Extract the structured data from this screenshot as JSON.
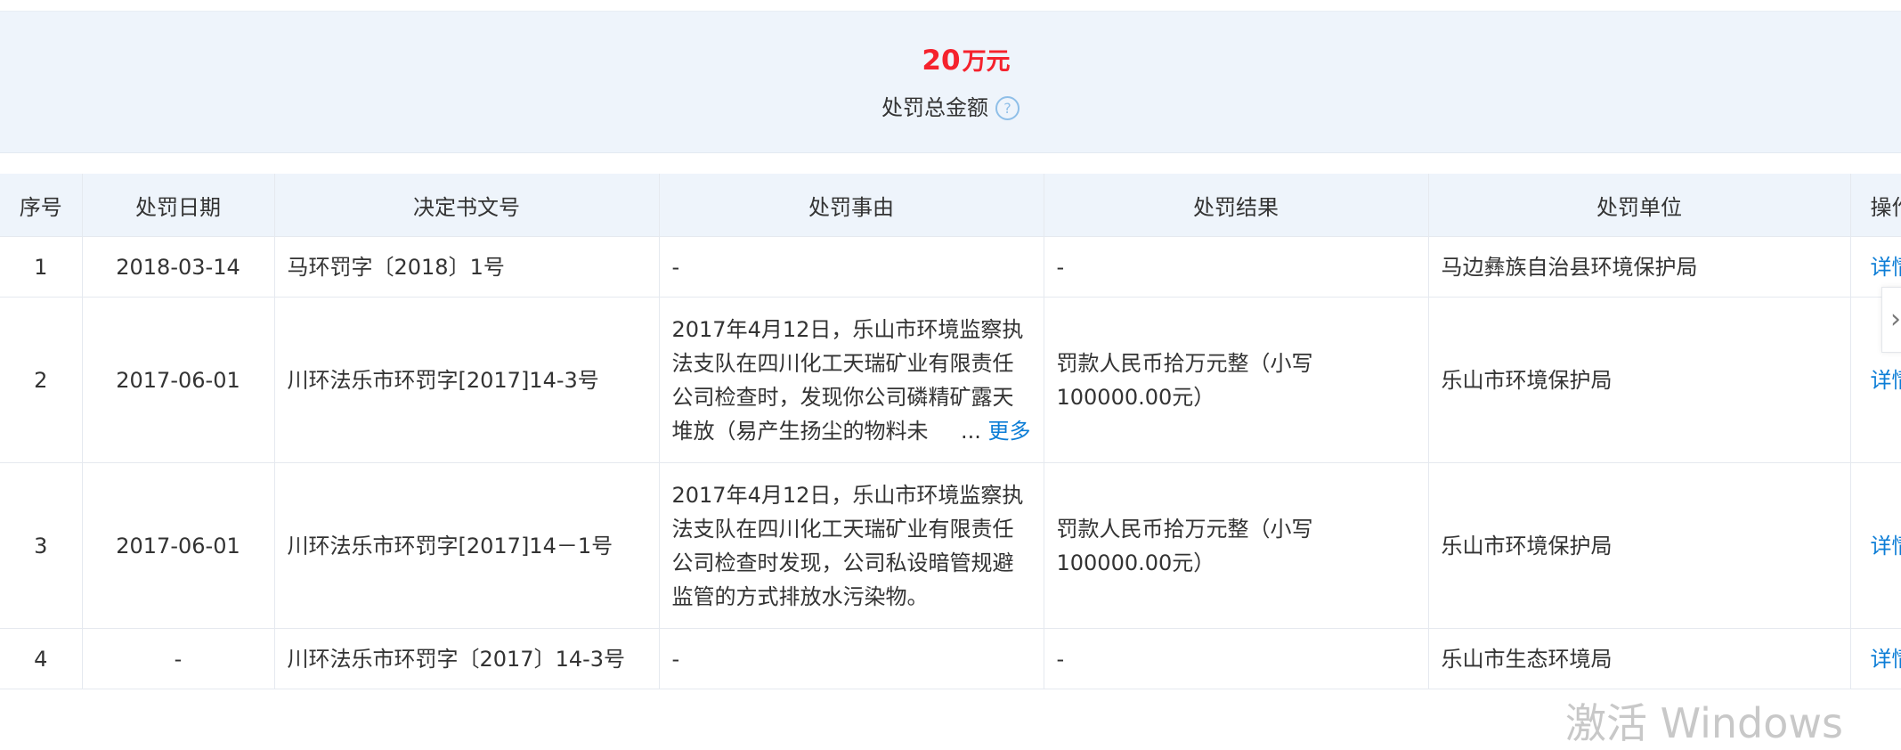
{
  "summary": {
    "amount_value": "20",
    "amount_unit": "万元",
    "label": "处罚总金额",
    "help_icon": "?"
  },
  "table": {
    "headers": [
      "序号",
      "处罚日期",
      "决定书文号",
      "处罚事由",
      "处罚结果",
      "处罚单位",
      "操作"
    ],
    "rows": [
      {
        "index": "1",
        "date": "2018-03-14",
        "doc_no": "马环罚字〔2018〕1号",
        "reason": "-",
        "result": "-",
        "unit": "马边彝族自治县环境保护局",
        "action": "详情"
      },
      {
        "index": "2",
        "date": "2017-06-01",
        "doc_no": "川环法乐市环罚字[2017]14-3号",
        "reason": "2017年4月12日，乐山市环境监察执法支队在四川化工天瑞矿业有限责任公司检查时，发现你公司磷精矿露天堆放（易产生扬尘的物料未",
        "reason_ellipsis": "...",
        "more": "更多",
        "result": "罚款人民币拾万元整（小写100000.00元）",
        "unit": "乐山市环境保护局",
        "action": "详情"
      },
      {
        "index": "3",
        "date": "2017-06-01",
        "doc_no": "川环法乐市环罚字[2017]14－1号",
        "reason": "2017年4月12日，乐山市环境监察执法支队在四川化工天瑞矿业有限责任公司检查时发现，公司私设暗管规避监管的方式排放水污染物。",
        "result": "罚款人民币拾万元整（小写100000.00元）",
        "unit": "乐山市环境保护局",
        "action": "详情"
      },
      {
        "index": "4",
        "date": "-",
        "doc_no": "川环法乐市环罚字〔2017〕14-3号",
        "reason": "-",
        "result": "-",
        "unit": "乐山市生态环境局",
        "action": "详情"
      }
    ]
  },
  "scroll_arrow": "›",
  "watermark": "激活 Windows"
}
